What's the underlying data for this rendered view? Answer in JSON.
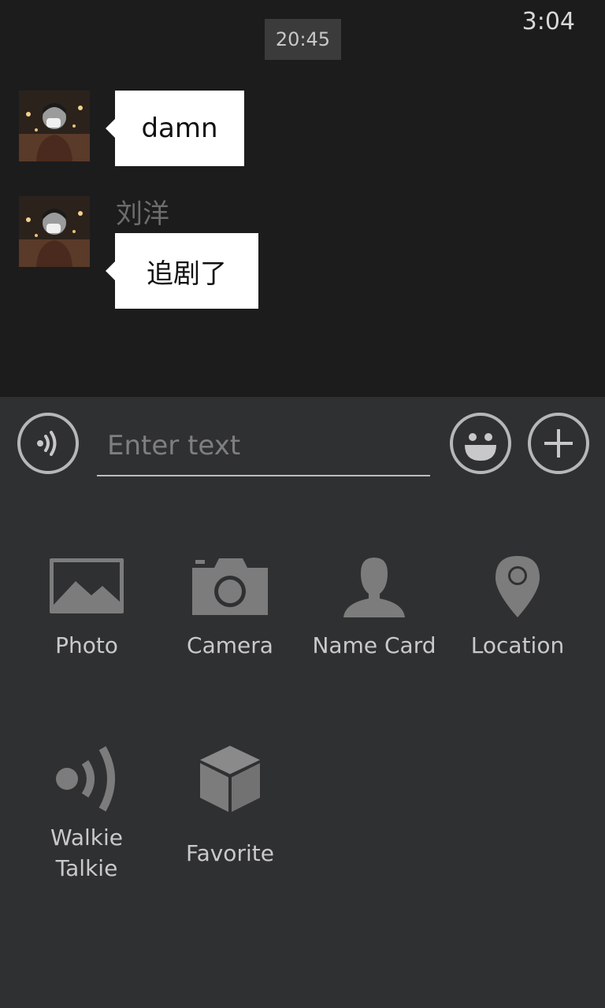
{
  "status_bar": {
    "time": "3:04"
  },
  "conversation": {
    "timestamp": "20:45",
    "messages": [
      {
        "text": "damn",
        "sender": ""
      },
      {
        "text": "追剧了",
        "sender": "刘洋"
      }
    ]
  },
  "composer": {
    "placeholder": "Enter text",
    "voice_icon": "voice-wave-icon",
    "emoji_icon": "smiley-icon",
    "more_icon": "plus-icon"
  },
  "attachments": [
    {
      "label": "Photo",
      "icon": "image-icon"
    },
    {
      "label": "Camera",
      "icon": "camera-icon"
    },
    {
      "label": "Name Card",
      "icon": "person-icon"
    },
    {
      "label": "Location",
      "icon": "map-pin-icon"
    },
    {
      "label": "Walkie\nTalkie",
      "icon": "walkie-talkie-icon"
    },
    {
      "label": "Favorite",
      "icon": "cube-icon"
    }
  ],
  "colors": {
    "chat_background": "#1c1c1d",
    "panel_background": "#2f3032",
    "icon_gray": "#7c7c7c",
    "bubble": "#ffffff"
  }
}
